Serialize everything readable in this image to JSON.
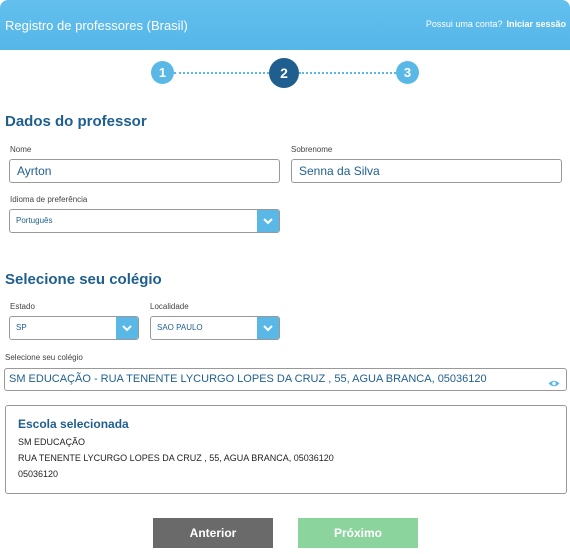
{
  "header": {
    "title": "Registro de professores (Brasil)",
    "account_question": "Possui uma conta?",
    "login_link": "Iniciar sessão"
  },
  "stepper": {
    "steps": [
      "1",
      "2",
      "3"
    ],
    "current": 2
  },
  "teacher": {
    "section_title": "Dados do professor",
    "first_name_label": "Nome",
    "first_name": "Ayrton",
    "last_name_label": "Sobrenome",
    "last_name": "Senna da Silva",
    "language_label": "Idioma de preferência",
    "language": "Português"
  },
  "school": {
    "section_title": "Selecione seu colégio",
    "state_label": "Estado",
    "state": "SP",
    "city_label": "Localidade",
    "city": "SAO PAULO",
    "school_label": "Selecione seu colégio",
    "school_value": "SM EDUCAÇÃO - RUA TENENTE LYCURGO LOPES DA CRUZ , 55, AGUA BRANCA, 05036120"
  },
  "selected_school": {
    "title": "Escola selecionada",
    "name": "SM EDUCAÇÃO",
    "address": "RUA TENENTE LYCURGO LOPES DA CRUZ , 55, AGUA BRANCA, 05036120",
    "postal_code": "05036120"
  },
  "buttons": {
    "previous": "Anterior",
    "next": "Próximo"
  },
  "colors": {
    "header": "#5ab8e6",
    "primary_dark": "#1f5f8f",
    "previous_button": "#6a6a6a",
    "next_button": "#8cd49e"
  },
  "icons": {
    "select_arrow": "chevron-down-icon",
    "view": "eye-icon"
  }
}
